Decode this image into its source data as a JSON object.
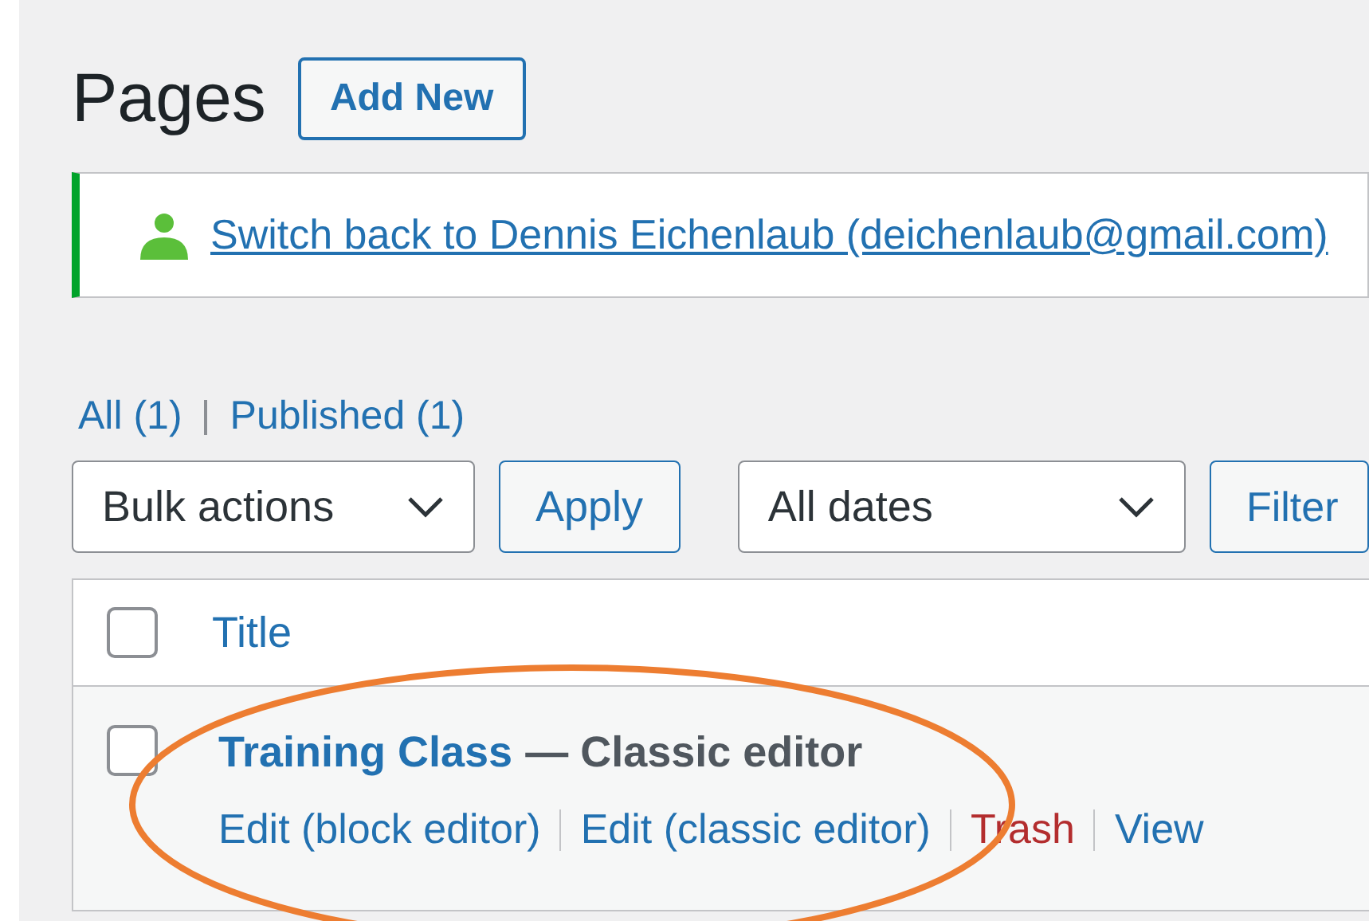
{
  "heading": "Pages",
  "add_new_button": "Add New",
  "notice": {
    "link": "Switch back to Dennis Eichenlaub (deichenlaub@gmail.com)"
  },
  "views": [
    {
      "label": "All",
      "count": "(1)",
      "selected": false
    },
    {
      "label": "Published",
      "count": "(1)",
      "selected": false
    }
  ],
  "bulk_actions": {
    "value": "Bulk actions",
    "button": "Apply"
  },
  "date_filter": {
    "value": "All dates",
    "button": "Filter"
  },
  "table": {
    "columns": [
      "Title"
    ],
    "rows": [
      {
        "title": "Training Class",
        "state": "— Classic editor",
        "checked": false,
        "actions": [
          {
            "label": "Edit (block editor)",
            "kind": "link"
          },
          {
            "label": "Edit (classic editor)",
            "kind": "link"
          },
          {
            "label": "Trash",
            "kind": "delete"
          },
          {
            "label": "View",
            "kind": "link"
          }
        ]
      }
    ]
  },
  "header_checked": false
}
